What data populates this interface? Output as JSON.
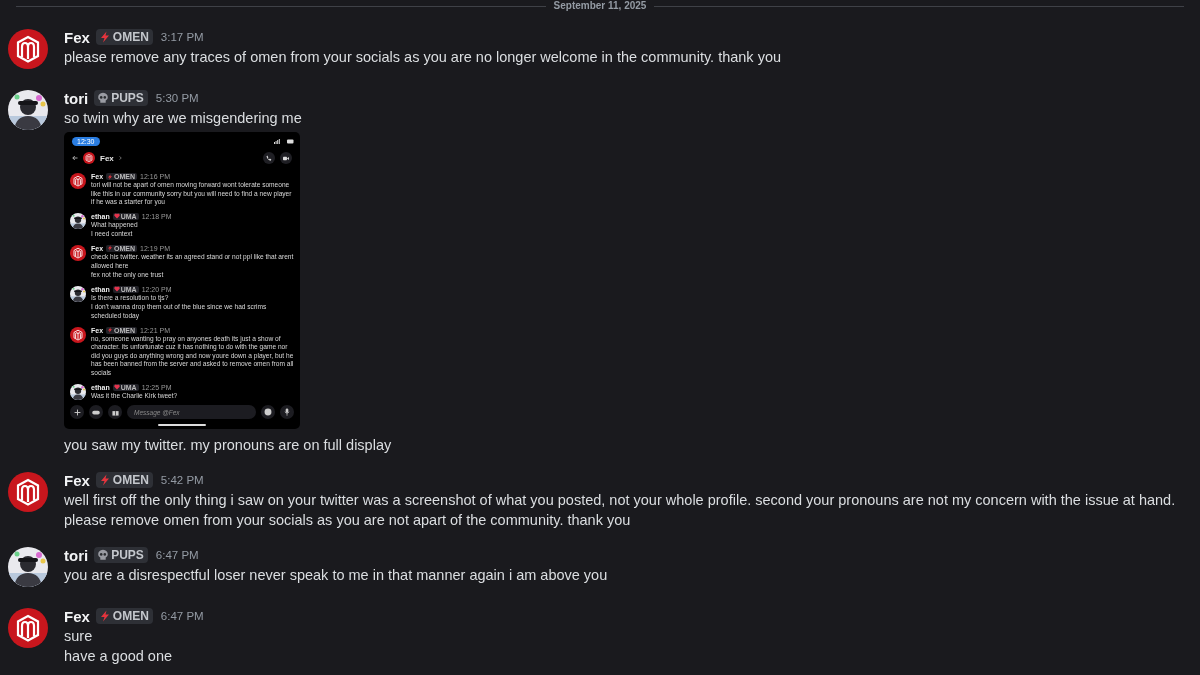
{
  "date_divider": "September 11, 2025",
  "messages": [
    {
      "author": "Fex",
      "kind": "logo",
      "tag": {
        "kind": "bolt",
        "label": "OMEN"
      },
      "time": "3:17 PM",
      "blocks": [
        {
          "kind": "text",
          "text": "please remove any traces of omen from your socials as you are no longer welcome in the community. thank you"
        }
      ]
    },
    {
      "author": "tori",
      "tag": {
        "kind": "skull",
        "label": "PUPS"
      },
      "time": "5:30 PM",
      "blocks": [
        {
          "kind": "text",
          "text": "so twin why are we misgendering me"
        },
        {
          "kind": "screenshot",
          "status_time": "12:30",
          "chat_title": "Fex",
          "composer_placeholder": "Message @Fex",
          "messages": [
            {
              "author": "Fex",
              "kind": "logo",
              "tag": {
                "kind": "bolt",
                "label": "OMEN"
              },
              "time": "12:16 PM",
              "lines": [
                "tori will not be apart of omen moving forward wont tolerate someone like this in our community sorry but you will need to find a new player if he was a starter for you"
              ]
            },
            {
              "author": "ethan",
              "tag": {
                "kind": "heart",
                "label": "UMA"
              },
              "time": "12:18 PM",
              "lines": [
                "What happened",
                "I need context"
              ]
            },
            {
              "author": "Fex",
              "kind": "logo",
              "tag": {
                "kind": "bolt",
                "label": "OMEN"
              },
              "time": "12:19 PM",
              "lines": [
                "check his twitter. weather its an agreed stand or not ppl like that arent allowed here",
                "fex not the only one trust"
              ]
            },
            {
              "author": "ethan",
              "tag": {
                "kind": "heart",
                "label": "UMA"
              },
              "time": "12:20 PM",
              "lines": [
                "Is there a resolution to tjs?",
                "I don't wanna drop them out of the blue since we had scrims scheduled today"
              ]
            },
            {
              "author": "Fex",
              "kind": "logo",
              "tag": {
                "kind": "bolt",
                "label": "OMEN"
              },
              "time": "12:21 PM",
              "lines": [
                "no, someone wanting to pray on anyones death its just a show of character. its unfortunate cuz it has nothing to do with the game nor did you guys do anything wrong and now youre down a player, but he has been banned from the server and asked to remove omen from all socials"
              ]
            },
            {
              "author": "ethan",
              "tag": {
                "kind": "heart",
                "label": "UMA"
              },
              "time": "12:25 PM",
              "lines": [
                "Was it the Charlie Kirk tweet?"
              ]
            }
          ]
        },
        {
          "kind": "text",
          "text": "you saw my twitter. my pronouns are on full display"
        }
      ]
    },
    {
      "author": "Fex",
      "kind": "logo",
      "tag": {
        "kind": "bolt",
        "label": "OMEN"
      },
      "time": "5:42 PM",
      "blocks": [
        {
          "kind": "text",
          "text": "well first off the only thing i saw on your twitter was a screenshot of what you posted, not your whole profile. second your pronouns are not my concern with the issue at hand. please remove omen from your socials as you are not apart of the community. thank you"
        }
      ]
    },
    {
      "author": "tori",
      "tag": {
        "kind": "skull",
        "label": "PUPS"
      },
      "time": "6:47 PM",
      "blocks": [
        {
          "kind": "text",
          "text": "you are a disrespectful loser never speak to me in that manner again i am above you"
        }
      ]
    },
    {
      "author": "Fex",
      "kind": "logo",
      "tag": {
        "kind": "bolt",
        "label": "OMEN"
      },
      "time": "6:47 PM",
      "blocks": [
        {
          "kind": "text",
          "text": "sure"
        },
        {
          "kind": "text",
          "text": "have a good one"
        }
      ]
    }
  ]
}
